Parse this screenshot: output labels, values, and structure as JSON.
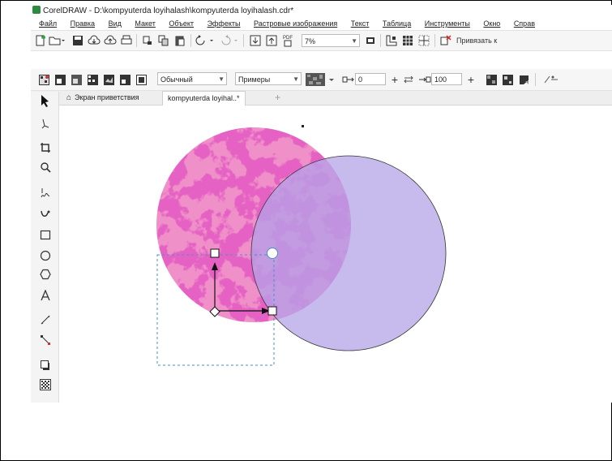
{
  "window": {
    "title": "CorelDRAW - D:\\kompyuterda loyihalash\\kompyuterda loyihalash.cdr*"
  },
  "menu": [
    "Файл",
    "Правка",
    "Вид",
    "Макет",
    "Объект",
    "Эффекты",
    "Растровые изображения",
    "Текст",
    "Таблица",
    "Инструменты",
    "Окно",
    "Справ"
  ],
  "toolbar": {
    "zoom": "7%",
    "snap_label": "Привязать к"
  },
  "property_bar": {
    "mode": "Обычный",
    "preset": "Примеры",
    "offset": "0",
    "percent": "100"
  },
  "tabs": [
    {
      "label": "Экран приветствия"
    },
    {
      "label": "kompyuterda loyihal..*"
    },
    {
      "label": "+"
    }
  ],
  "colors": {
    "pink_base": "#e870b8",
    "pink_dark": "#c8208a",
    "lavender": "#c4b6ec",
    "lavender_stroke": "#3a3a3a",
    "overlap": "#b878d8"
  }
}
